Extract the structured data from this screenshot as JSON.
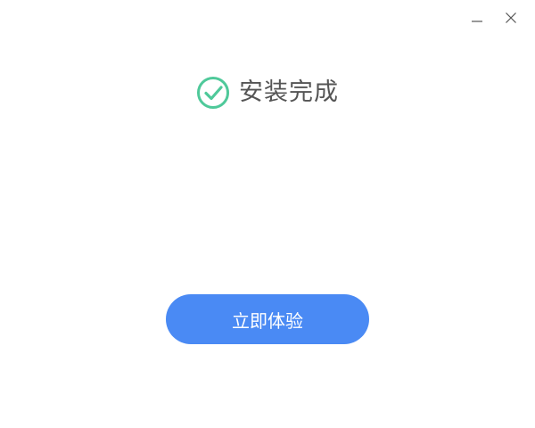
{
  "window": {
    "minimize_icon": "minimize-icon",
    "close_icon": "close-icon"
  },
  "header": {
    "icon": "check-circle-icon",
    "title": "安装完成"
  },
  "main": {
    "action_label": "立即体验"
  },
  "colors": {
    "accent": "#4a8af4",
    "success": "#4fc99a",
    "title_text": "#555555",
    "window_control": "#555555"
  }
}
